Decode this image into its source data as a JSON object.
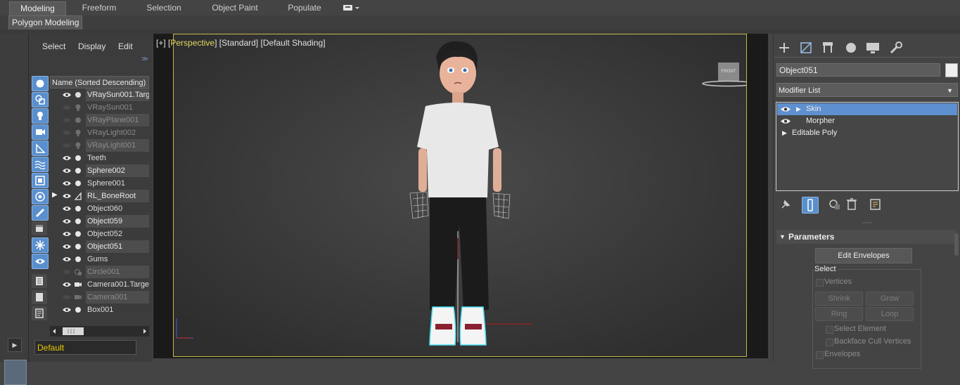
{
  "ribbon": {
    "tabs": [
      "Modeling",
      "Freeform",
      "Selection",
      "Object Paint",
      "Populate"
    ],
    "active_tab": "Modeling",
    "subtab": "Polygon Modeling"
  },
  "scene_explorer": {
    "menu": [
      "Select",
      "Display",
      "Edit"
    ],
    "column_header": "Name (Sorted Descending)",
    "items": [
      {
        "name": "VRaySun001.Targe",
        "type": "target",
        "visible": true
      },
      {
        "name": "VRaySun001",
        "type": "light",
        "visible": false
      },
      {
        "name": "VRayPlane001",
        "type": "geometry",
        "visible": false
      },
      {
        "name": "VRayLight002",
        "type": "light",
        "visible": false
      },
      {
        "name": "VRayLight001",
        "type": "light",
        "visible": false
      },
      {
        "name": "Teeth",
        "type": "geometry",
        "visible": true
      },
      {
        "name": "Sphere002",
        "type": "geometry",
        "visible": true
      },
      {
        "name": "Sphere001",
        "type": "geometry",
        "visible": true
      },
      {
        "name": "RL_BoneRoot",
        "type": "bone",
        "visible": true
      },
      {
        "name": "Object060",
        "type": "geometry",
        "visible": true
      },
      {
        "name": "Object059",
        "type": "geometry",
        "visible": true
      },
      {
        "name": "Object052",
        "type": "geometry",
        "visible": true
      },
      {
        "name": "Object051",
        "type": "geometry",
        "visible": true
      },
      {
        "name": "Gums",
        "type": "geometry",
        "visible": true
      },
      {
        "name": "Circle001",
        "type": "shape",
        "visible": false
      },
      {
        "name": "Camera001.Targe",
        "type": "camera",
        "visible": true
      },
      {
        "name": "Camera001",
        "type": "camera",
        "visible": false
      },
      {
        "name": "Box001",
        "type": "geometry",
        "visible": true
      }
    ],
    "layer": "Default"
  },
  "viewport": {
    "plus": "[+]",
    "view": "Perspective",
    "mode": "[Standard]",
    "shading": "[Default Shading]",
    "viewcube_label": "FRONT",
    "accent_color": "#c6b64a"
  },
  "command_panel": {
    "object_name": "Object051",
    "modifier_list_label": "Modifier List",
    "stack": [
      {
        "name": "Skin",
        "selected": true
      },
      {
        "name": "Morpher",
        "selected": false
      },
      {
        "name": "Editable Poly",
        "selected": false
      }
    ],
    "rollout_title": "Parameters",
    "edit_envelopes": "Edit Envelopes",
    "select_group": "Select",
    "vertices": "Vertices",
    "shrink": "Shrink",
    "grow": "Grow",
    "ring": "Ring",
    "loop": "Loop",
    "select_element": "Select Element",
    "backface_cull": "Backface Cull Vertices",
    "envelopes": "Envelopes",
    "selection_color": "#5e8fcf"
  }
}
